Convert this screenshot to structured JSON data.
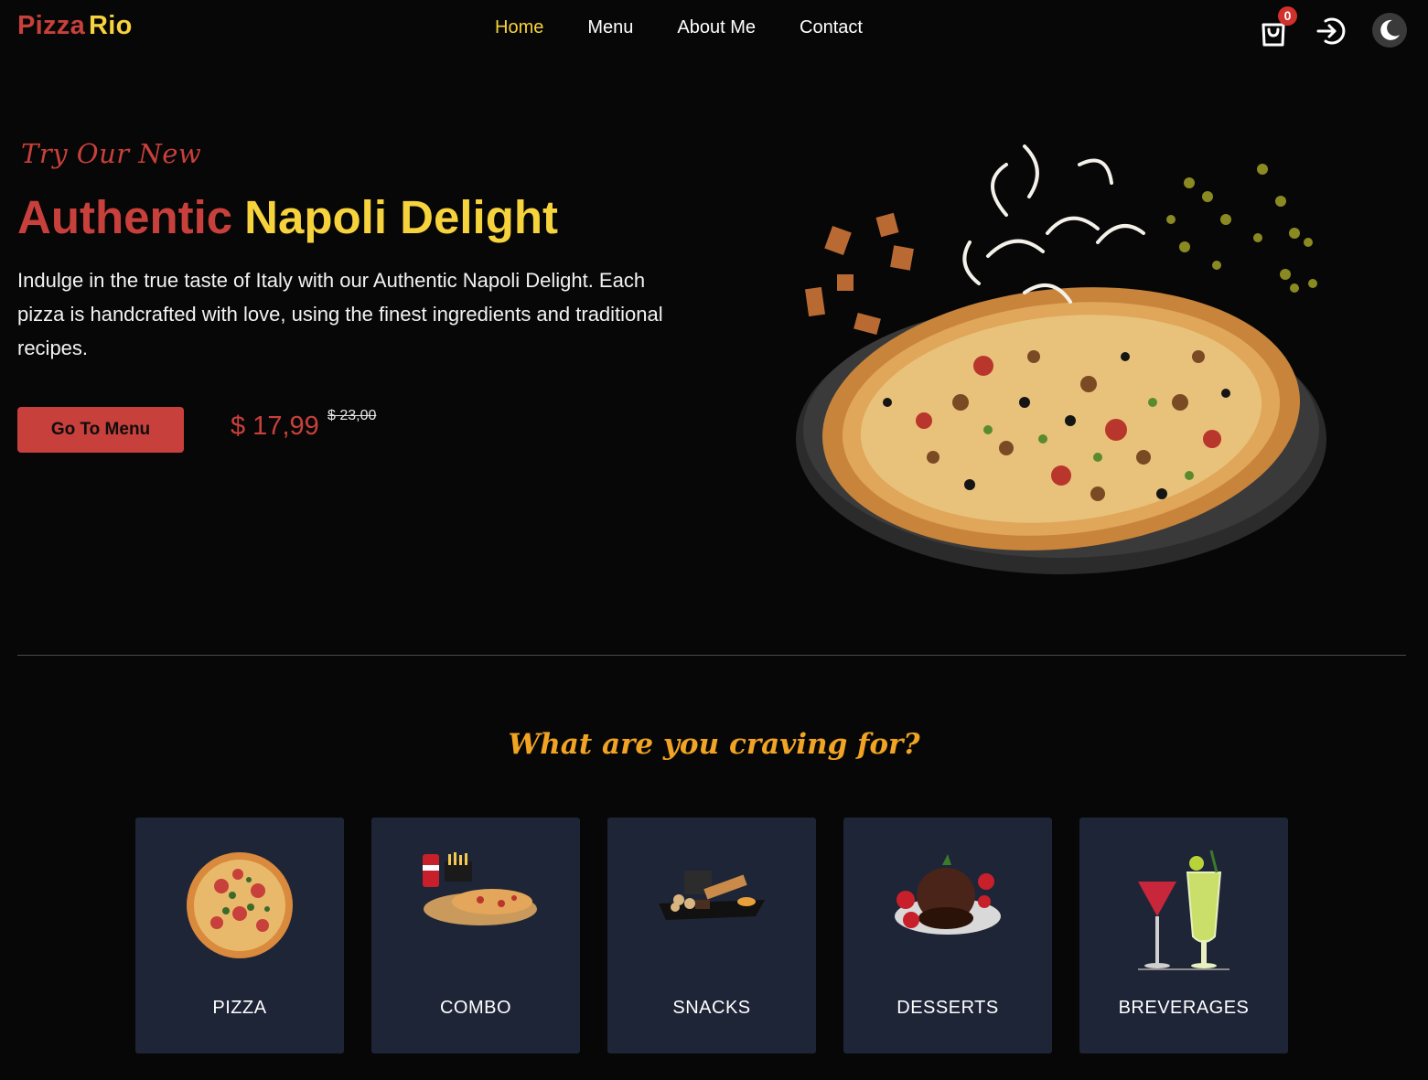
{
  "brand": {
    "part1": "Pizza",
    "part2": "Rio"
  },
  "nav": {
    "links": [
      {
        "label": "Home",
        "active": true
      },
      {
        "label": "Menu",
        "active": false
      },
      {
        "label": "About Me",
        "active": false
      },
      {
        "label": "Contact",
        "active": false
      }
    ],
    "cart_count": "0",
    "icons": [
      "cart-icon",
      "login-icon",
      "moon-icon"
    ]
  },
  "hero": {
    "tagline": "Try Our New",
    "title_part1": "Authentic",
    "title_part2": "Napoli Delight",
    "description": "Indulge in the true taste of Italy with our Authentic Napoli Delight. Each pizza is handcrafted with love, using the finest ingredients and traditional recipes.",
    "cta_label": "Go To Menu",
    "price_current": "$ 17,99",
    "price_old": "$ 23,00"
  },
  "categories_section": {
    "title": "What are you craving for?",
    "items": [
      {
        "label": "PIZZA",
        "icon": "pizza-image"
      },
      {
        "label": "COMBO",
        "icon": "combo-image"
      },
      {
        "label": "SNACKS",
        "icon": "snacks-image"
      },
      {
        "label": "DESSERTS",
        "icon": "desserts-image"
      },
      {
        "label": "BREVERAGES",
        "icon": "beverages-image"
      }
    ]
  },
  "colors": {
    "background": "#070707",
    "brand_red": "#c8403b",
    "brand_yellow": "#f6d23c",
    "accent_orange": "#f1a323",
    "card_bg": "#1e2537"
  }
}
